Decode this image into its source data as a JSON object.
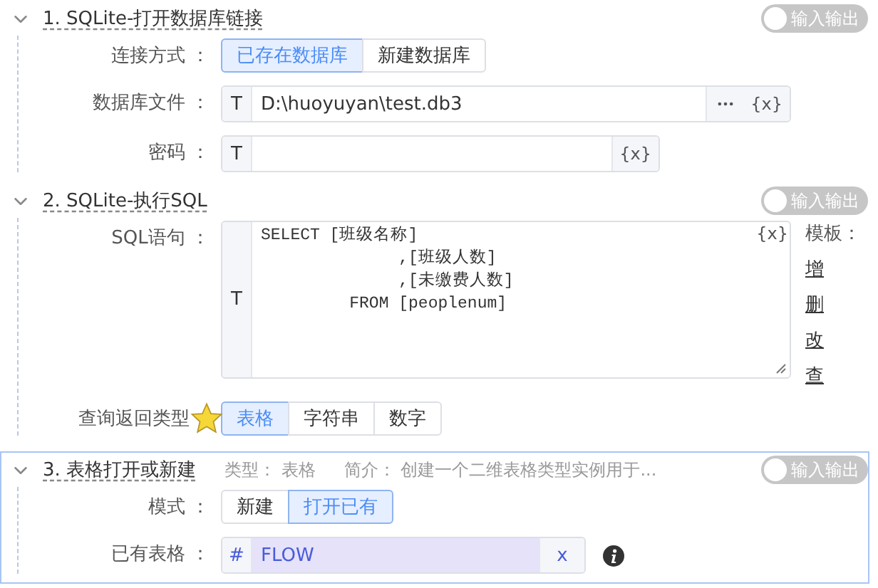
{
  "sections": [
    {
      "title": "1. SQLite-打开数据库链接",
      "expanded": true,
      "toggle": {
        "label": "输入输出",
        "on": false
      },
      "fields": [
        {
          "kind": "segmented",
          "label": "连接方式 ：",
          "options": [
            {
              "label": "已存在数据库",
              "selected": true
            },
            {
              "label": "新建数据库",
              "selected": false
            }
          ]
        },
        {
          "kind": "input",
          "label": "数据库文件 ：",
          "prefix": "T",
          "value": "D:\\huoyuyan\\test.db3",
          "more": true,
          "variable": "{x}"
        },
        {
          "kind": "input",
          "label": "密码 ：",
          "prefix": "T",
          "variable": "{x}"
        }
      ]
    },
    {
      "title": "2. SQLite-执行SQL",
      "expanded": true,
      "toggle": {
        "label": "输入输出",
        "on": false
      },
      "fields": [
        {
          "kind": "textarea",
          "label": "SQL语句 ：",
          "prefix": "T",
          "lines": [
            "SELECT [班级名称]",
            "              ,[班级人数]",
            "              ,[未缴费人数]",
            "         FROM [peoplenum]"
          ],
          "variable": "{x}",
          "template_title": "模板：",
          "templates": [
            "增",
            "删",
            "改",
            "查"
          ]
        },
        {
          "kind": "segmented",
          "label": "查询返回类型",
          "starred": true,
          "options": [
            {
              "label": "表格",
              "selected": true
            },
            {
              "label": "字符串",
              "selected": false
            },
            {
              "label": "数字",
              "selected": false
            }
          ]
        }
      ]
    },
    {
      "title": "3. 表格打开或新建",
      "expanded": true,
      "highlighted": true,
      "meta": [
        "类型： 表格",
        "简介： 创建一个二维表格类型实例用于..."
      ],
      "toggle": {
        "label": "输入输出",
        "on": false
      },
      "fields": [
        {
          "kind": "segmented",
          "label": "模式 ：",
          "options": [
            {
              "label": "新建",
              "selected": false
            },
            {
              "label": "打开已有",
              "selected": true
            }
          ]
        },
        {
          "kind": "variable",
          "label": "已有表格 ：",
          "prefix": "#",
          "value": "FLOW",
          "clear": "x",
          "info": true
        }
      ]
    }
  ]
}
